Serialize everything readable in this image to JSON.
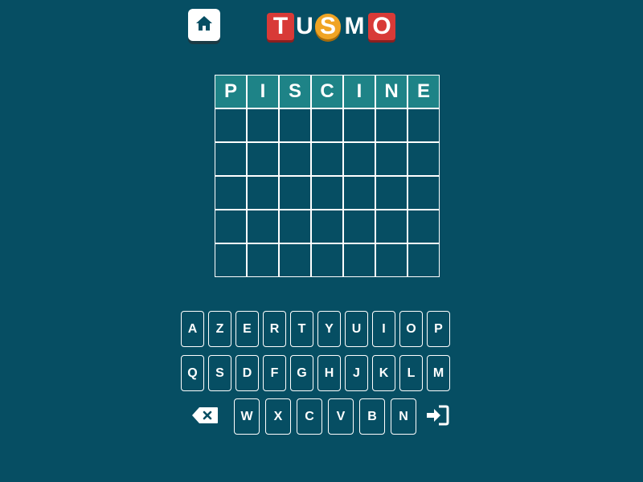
{
  "header": {
    "home_icon": "home-icon",
    "logo_letters": [
      "T",
      "U",
      "S",
      "M",
      "O"
    ]
  },
  "grid": {
    "rows": [
      [
        "P",
        "I",
        "S",
        "C",
        "I",
        "N",
        "E"
      ],
      [
        "",
        "",
        "",
        "",
        "",
        "",
        ""
      ],
      [
        "",
        "",
        "",
        "",
        "",
        "",
        ""
      ],
      [
        "",
        "",
        "",
        "",
        "",
        "",
        ""
      ],
      [
        "",
        "",
        "",
        "",
        "",
        "",
        ""
      ],
      [
        "",
        "",
        "",
        "",
        "",
        "",
        ""
      ]
    ]
  },
  "keyboard": {
    "row1": [
      "A",
      "Z",
      "E",
      "R",
      "T",
      "Y",
      "U",
      "I",
      "O",
      "P"
    ],
    "row2": [
      "Q",
      "S",
      "D",
      "F",
      "G",
      "H",
      "J",
      "K",
      "L",
      "M"
    ],
    "row3": [
      "W",
      "X",
      "C",
      "V",
      "B",
      "N"
    ],
    "backspace_icon": "backspace-icon",
    "enter_icon": "enter-icon"
  },
  "colors": {
    "background": "#064e63",
    "filled_cell": "#1e8387",
    "logo_red": "#d83a37",
    "logo_yellow": "#f0a424"
  }
}
